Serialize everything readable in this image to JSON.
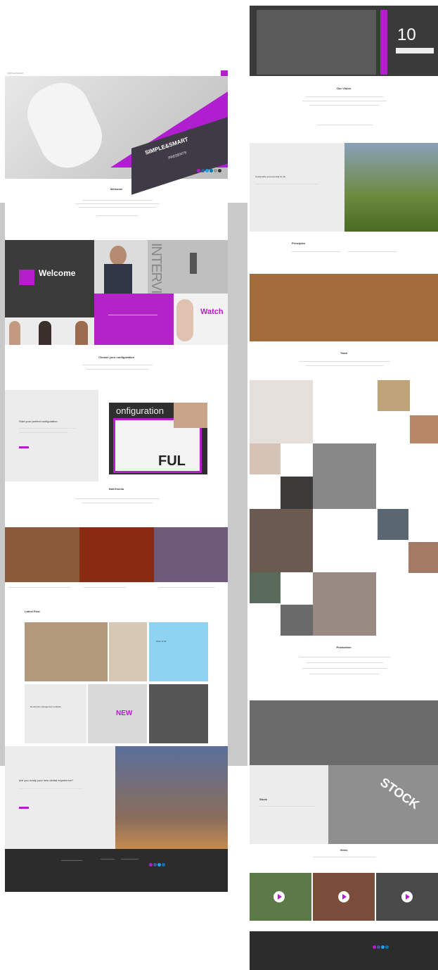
{
  "left": {
    "logo": "SIMPLE&SMART",
    "hero": {
      "brand": "SIMPLE&SMART",
      "sub": "PRESENTS"
    },
    "welcome_title": "Welcome",
    "welcome_tile": "Welcome",
    "interview_text": "INTERVIEW",
    "watch_text": "Watch",
    "config_title": "Choose your configuration",
    "config_panel_title": "Start your perfect configuration",
    "config_graphic": {
      "word": "onfiguration",
      "word2": "FUL"
    },
    "cta_label": "",
    "send_events_title": "Hall Events",
    "latest_title": "Latest Post",
    "post_tile_1": "Dolor & Sit",
    "post_tile_2": "Dental lab management software",
    "post_tile_3": "NEW",
    "bottom_panel_title": "Are you ready your new dental experience?",
    "colors": {
      "accent": "#b61ecb",
      "dark": "#3b3b3b"
    }
  },
  "right": {
    "big_number": "10",
    "section_title": "Our Vision",
    "wine_title": "Sustainable and essential for life",
    "principles_title": "Principles",
    "team_title": "Team",
    "manifesto_title": "Production",
    "stock_text": "STOCK",
    "stock_panel_title": "Stock",
    "video_title": "Video"
  }
}
